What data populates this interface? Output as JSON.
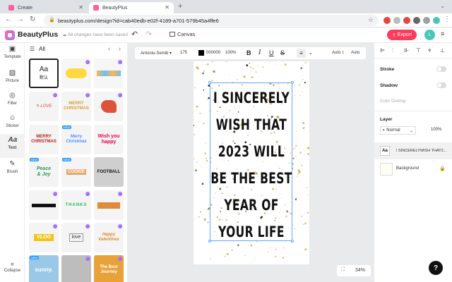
{
  "browser": {
    "tabs": [
      {
        "label": "Create"
      },
      {
        "label": "BeautyPlus"
      }
    ],
    "url": "beautyplus.com/design?id=cab40edb-e02f-4189-a701-579b45a4ffe6"
  },
  "header": {
    "brand": "BeautyPlus",
    "save_status": "All changes have been saved",
    "canvas_label": "Canvas",
    "export_label": "Export",
    "avatar_initial": "L"
  },
  "rail": {
    "items": [
      {
        "label": "Template",
        "icon": "template-icon"
      },
      {
        "label": "Picture",
        "icon": "picture-icon"
      },
      {
        "label": "Filter",
        "icon": "filter-icon"
      },
      {
        "label": "Sticker",
        "icon": "sticker-icon"
      },
      {
        "label": "Text",
        "icon": "text-icon"
      },
      {
        "label": "Brush",
        "icon": "brush-icon"
      }
    ],
    "collapse_label": "Collapse"
  },
  "panel": {
    "filter_label": "All",
    "thumbs": [
      {
        "text": "Aa\n默认"
      },
      {
        "text": ""
      },
      {
        "text": ""
      },
      {
        "text": "Merry Christmas"
      },
      {
        "text": ""
      },
      {
        "text": "LOVE"
      },
      {
        "text": "MERRY CHRISTMAS"
      },
      {
        "text": "Merry Christmas"
      },
      {
        "text": "Wish you happy"
      },
      {
        "text": "Peace & Joy"
      },
      {
        "text": "COOKIE"
      },
      {
        "text": "FOOTBALL"
      },
      {
        "text": ""
      },
      {
        "text": "THANKS"
      },
      {
        "text": ""
      },
      {
        "text": "VLOG"
      },
      {
        "text": "love"
      },
      {
        "text": "Happy Valentines"
      },
      {
        "text": "sunny."
      },
      {
        "text": ""
      },
      {
        "text": "The Best Journey"
      }
    ]
  },
  "textbar": {
    "font": "Antonio-Semib",
    "size": "175",
    "color_hex": "000000",
    "opacity": "100%",
    "letter_spacing": "Auto",
    "line_height": "Auto"
  },
  "poster": {
    "lines": [
      "I SINCERELY",
      "WISH THAT",
      "2023 WILL",
      "BE THE BEST",
      "YEAR OF",
      "YOUR LIFE"
    ]
  },
  "zoom": "34%",
  "right": {
    "stroke_label": "Stroke",
    "shadow_label": "Shadow",
    "color_overlay_label": "Color Overlay",
    "layer_label": "Layer",
    "blend_mode": "Normal",
    "opacity": "100%",
    "layers": [
      {
        "name": "I SINCERELYWISH THAT2..."
      },
      {
        "name": "Background"
      }
    ]
  },
  "colors": {
    "accent": "#ff3b5c",
    "selection": "#5fa8ff",
    "sparkle": "#d9a23a"
  }
}
